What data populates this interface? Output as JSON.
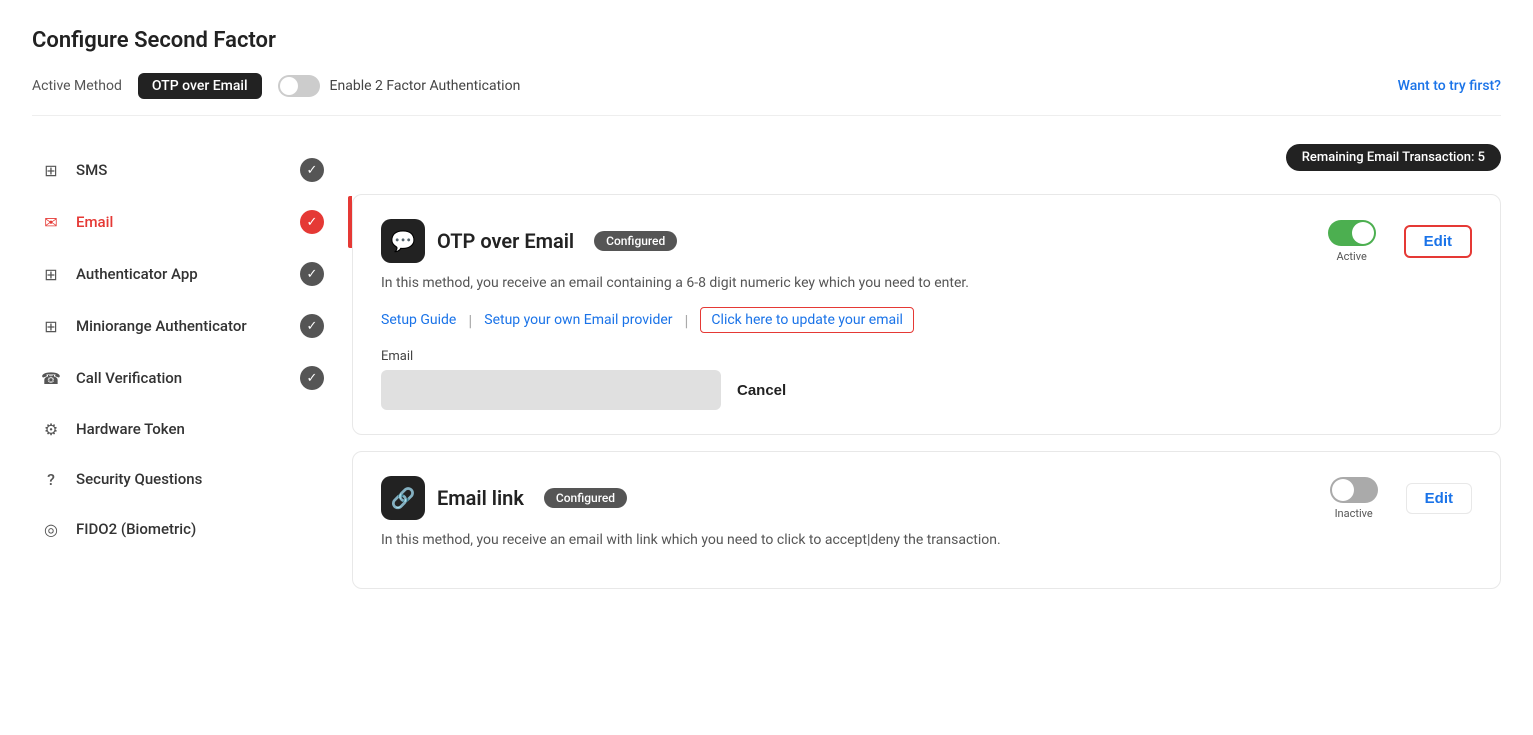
{
  "page": {
    "title": "Configure Second Factor"
  },
  "header": {
    "active_method_label": "Active Method",
    "active_method_value": "OTP over Email",
    "toggle_label": "Enable 2 Factor Authentication",
    "toggle_state": "off",
    "want_to_try_label": "Want to try first?"
  },
  "sidebar": {
    "items": [
      {
        "id": "sms",
        "label": "SMS",
        "icon": "⊞",
        "checked": true,
        "active": false
      },
      {
        "id": "email",
        "label": "Email",
        "icon": "✉",
        "checked": true,
        "active": true
      },
      {
        "id": "authenticator-app",
        "label": "Authenticator App",
        "icon": "⊞",
        "checked": true,
        "active": false
      },
      {
        "id": "miniorange-authenticator",
        "label": "Miniorange Authenticator",
        "icon": "⊞",
        "checked": true,
        "active": false
      },
      {
        "id": "call-verification",
        "label": "Call Verification",
        "icon": "☎",
        "checked": true,
        "active": false
      },
      {
        "id": "hardware-token",
        "label": "Hardware Token",
        "icon": "⚙",
        "checked": false,
        "active": false
      },
      {
        "id": "security-questions",
        "label": "Security Questions",
        "icon": "?",
        "checked": false,
        "active": false
      },
      {
        "id": "fido2",
        "label": "FIDO2 (Biometric)",
        "icon": "◎",
        "checked": false,
        "active": false
      }
    ]
  },
  "content": {
    "remaining_badge": "Remaining Email Transaction: 5",
    "method1": {
      "title": "OTP over Email",
      "configured_label": "Configured",
      "description": "In this method, you receive an email containing a 6-8 digit numeric key which you need to enter.",
      "setup_guide_label": "Setup Guide",
      "setup_email_provider_label": "Setup your own Email provider",
      "update_email_label": "Click here to update your email",
      "toggle_state": "active",
      "toggle_status": "Active",
      "edit_label": "Edit",
      "email_field_label": "Email",
      "cancel_label": "Cancel"
    },
    "method2": {
      "title": "Email link",
      "configured_label": "Configured",
      "description": "In this method, you receive an email with link which you need to click to accept|deny the transaction.",
      "toggle_state": "inactive",
      "toggle_status": "Inactive",
      "edit_label": "Edit"
    }
  }
}
